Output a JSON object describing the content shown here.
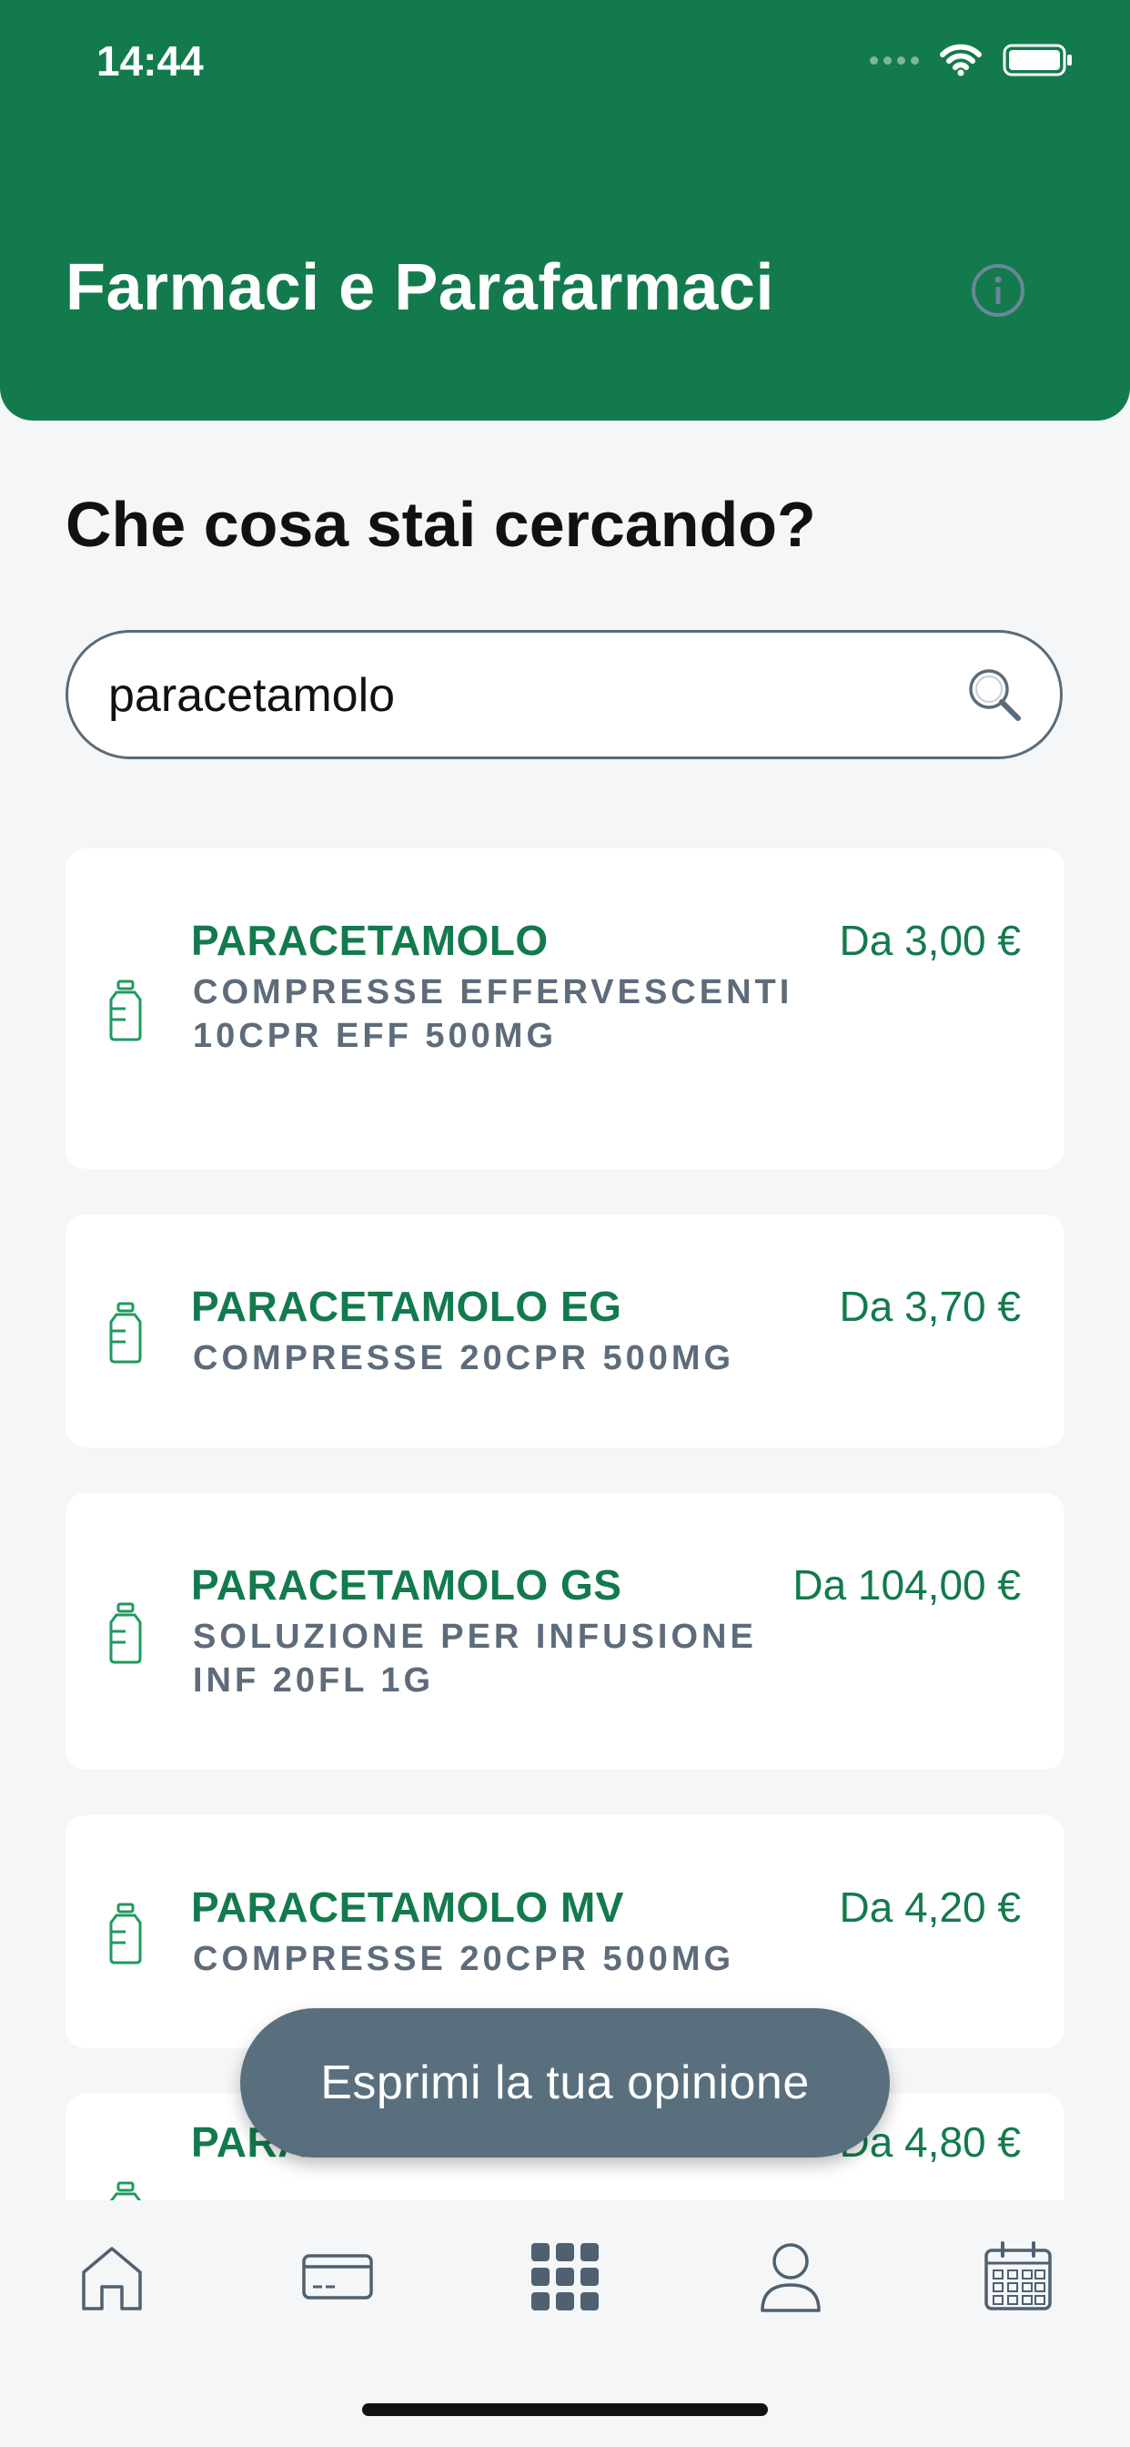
{
  "status_bar": {
    "time": "14:44"
  },
  "header": {
    "title": "Farmaci e Parafarmaci"
  },
  "search_section": {
    "question": "Che cosa stai cercando?",
    "query": "paracetamolo"
  },
  "results": [
    {
      "name": "PARACETAMOLO",
      "description": "COMPRESSE EFFERVESCENTI 10CPR EFF 500MG",
      "price": "Da 3,00 €"
    },
    {
      "name": "PARACETAMOLO EG",
      "description": "COMPRESSE 20CPR 500MG",
      "price": "Da 3,70 €"
    },
    {
      "name": "PARACETAMOLO GS",
      "description": "SOLUZIONE PER INFUSIONE INF 20FL 1G",
      "price": "Da 104,00 €"
    },
    {
      "name": "PARACETAMOLO MV",
      "description": "COMPRESSE 20CPR 500MG",
      "price": "Da 4,20 €"
    },
    {
      "name": "PARACETAMOLO MY",
      "description": "",
      "price": "Da 4,80 €"
    }
  ],
  "feedback_button": {
    "label": "Esprimi la tua opinione"
  },
  "tab_bar": {
    "items": [
      {
        "icon": "home-icon"
      },
      {
        "icon": "card-icon"
      },
      {
        "icon": "grid-icon"
      },
      {
        "icon": "profile-icon"
      },
      {
        "icon": "calendar-icon"
      }
    ]
  },
  "colors": {
    "primary_green": "#137a4d",
    "background": "#f4f6f8",
    "muted_text": "#5d6b7a",
    "toast": "#5a6f7d",
    "tab_icon": "#4f6070"
  }
}
